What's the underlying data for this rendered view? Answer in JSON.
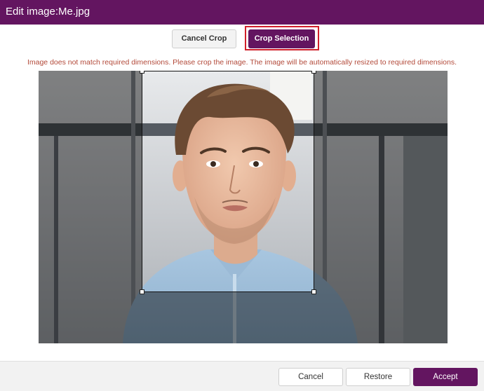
{
  "dialog": {
    "title": "Edit image:Me.jpg"
  },
  "toolbar": {
    "cancel_crop_label": "Cancel Crop",
    "crop_selection_label": "Crop Selection"
  },
  "warning": {
    "text": "Image does not match required dimensions. Please crop the image. The image will be automatically resized to required dimensions."
  },
  "footer": {
    "cancel_label": "Cancel",
    "restore_label": "Restore",
    "accept_label": "Accept"
  },
  "colors": {
    "brand": "#631560",
    "highlight": "#d0202a",
    "warning_text": "#b34a3a"
  }
}
